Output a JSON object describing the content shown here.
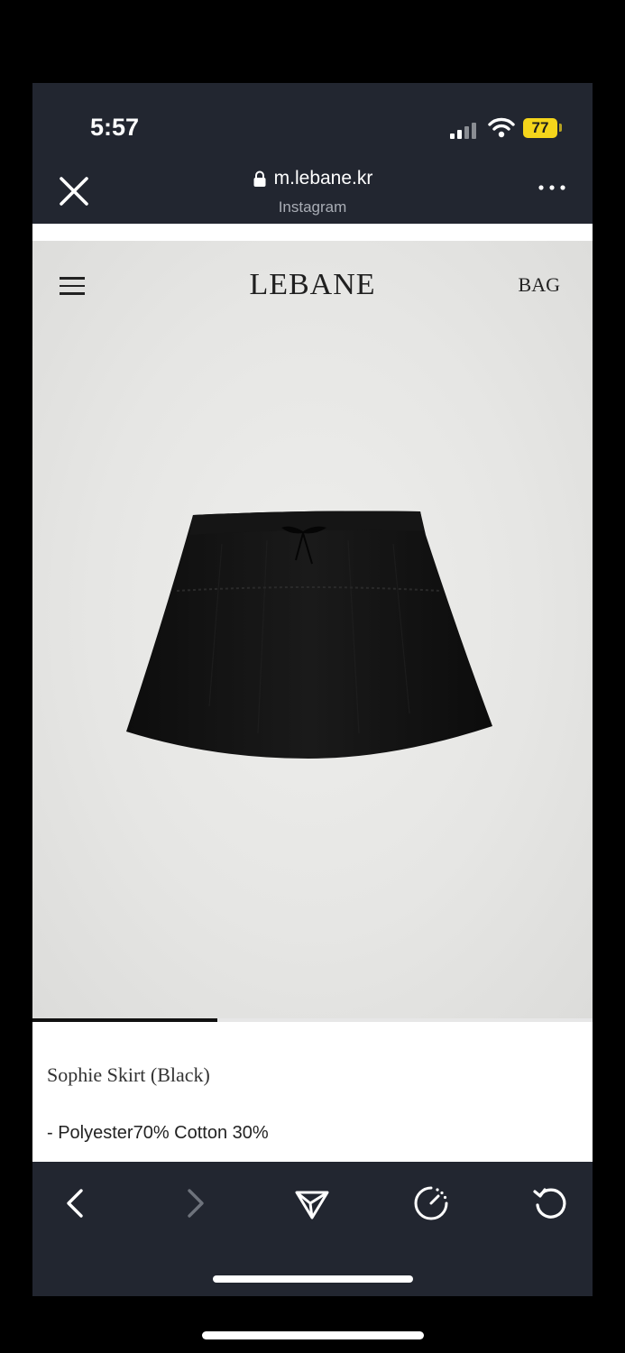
{
  "status_bar": {
    "time": "5:57",
    "battery": "77",
    "battery_color": "#f5d51b"
  },
  "browser": {
    "url": "m.lebane.kr",
    "source": "Instagram",
    "close_icon": "close-icon",
    "more_icon": "more-icon"
  },
  "site": {
    "logo": "LEBANE",
    "bag": "BAG",
    "menu_icon": "hamburger-icon"
  },
  "product": {
    "name": "Sophie Skirt (Black)",
    "description": "- Polyester70% Cotton 30%",
    "image_progress": 0.33
  },
  "toolbar": {
    "icons": [
      "back-icon",
      "forward-icon",
      "share-icon",
      "speed-icon",
      "reload-icon"
    ]
  }
}
